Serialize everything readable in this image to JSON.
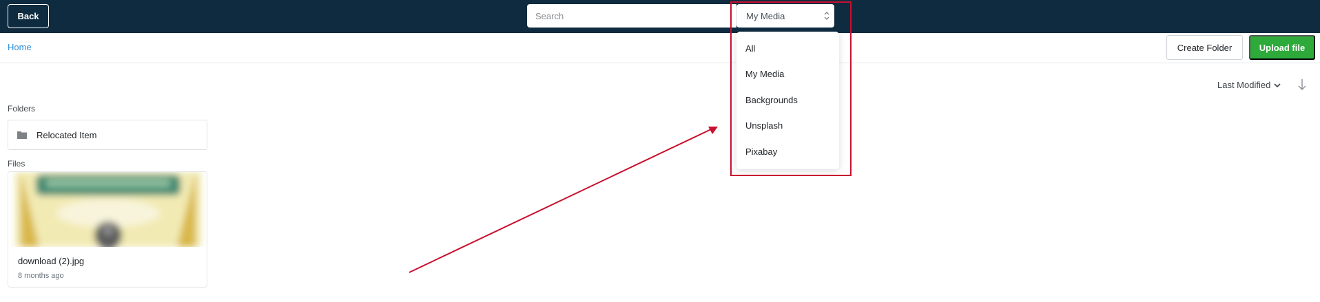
{
  "header": {
    "back_label": "Back",
    "search_placeholder": "Search",
    "media_select_value": "My Media"
  },
  "subheader": {
    "breadcrumb_home": "Home",
    "create_folder_label": "Create Folder",
    "upload_label": "Upload file"
  },
  "sort": {
    "label": "Last Modified"
  },
  "folders": {
    "section_label": "Folders",
    "items": [
      {
        "name": "Relocated Item"
      }
    ]
  },
  "files": {
    "section_label": "Files",
    "items": [
      {
        "name": "download (2).jpg",
        "modified": "8 months ago"
      }
    ]
  },
  "media_dropdown": {
    "options": [
      "All",
      "My Media",
      "Backgrounds",
      "Unsplash",
      "Pixabay"
    ]
  },
  "colors": {
    "topbar": "#0f2b40",
    "link": "#2f8fd8",
    "upload_button": "#2eaa3b",
    "annotation": "#c8102e"
  },
  "icons": [
    "select-arrows-icon",
    "chevron-down-icon",
    "sort-direction-icon",
    "folder-icon"
  ]
}
